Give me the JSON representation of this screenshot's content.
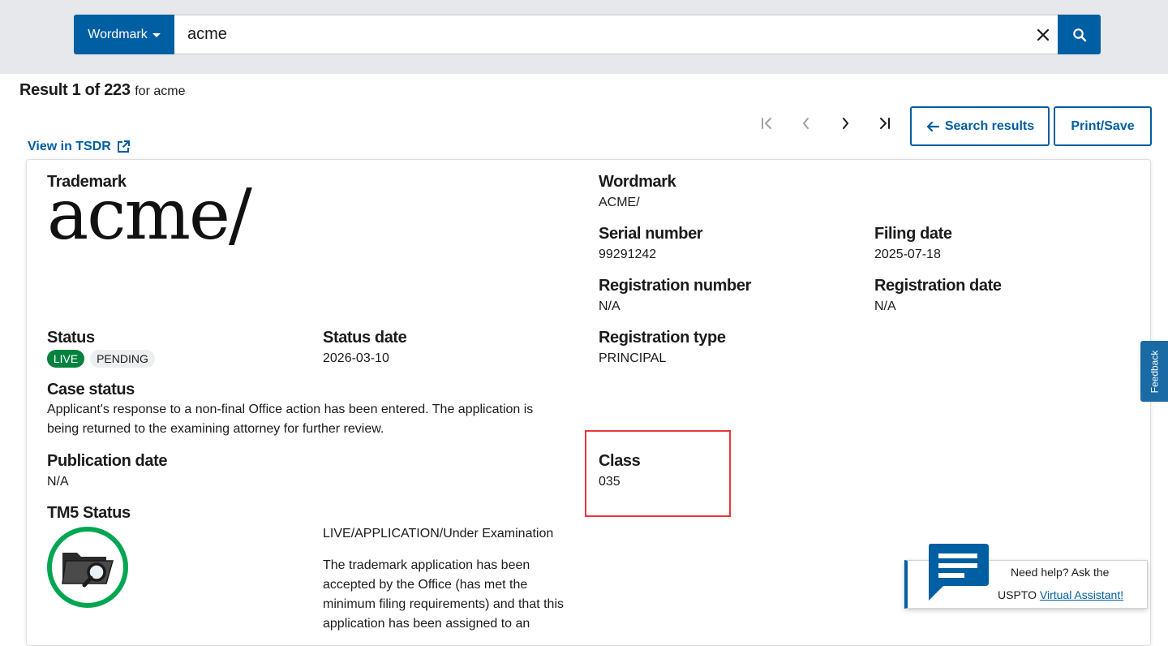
{
  "search": {
    "field_label": "Wordmark",
    "query": "acme"
  },
  "results": {
    "position": "Result 1 of 223",
    "for_text": "for acme"
  },
  "nav": {
    "search_results_label": "Search results",
    "print_save_label": "Print/Save",
    "tsdr_label": "View in TSDR"
  },
  "record": {
    "trademark_label": "Trademark",
    "mark_image_text": "acme/",
    "wordmark_label": "Wordmark",
    "wordmark_value": "ACME/",
    "serial_label": "Serial number",
    "serial_value": "99291242",
    "filing_date_label": "Filing date",
    "filing_date_value": "2025-07-18",
    "reg_number_label": "Registration number",
    "reg_number_value": "N/A",
    "reg_date_label": "Registration date",
    "reg_date_value": "N/A",
    "status_label": "Status",
    "status_tags": [
      "LIVE",
      "PENDING"
    ],
    "status_date_label": "Status date",
    "status_date_value": "2026-03-10",
    "reg_type_label": "Registration type",
    "reg_type_value": "PRINCIPAL",
    "case_status_label": "Case status",
    "case_status_line1": "Applicant's response to a non-final Office action has been entered. The application is",
    "case_status_line2": "being returned to the examining attorney for further review.",
    "pub_date_label": "Publication date",
    "pub_date_value": "N/A",
    "class_label": "Class",
    "class_value": "035",
    "tm5_label": "TM5 Status",
    "tm5_status": "LIVE/APPLICATION/Under Examination",
    "tm5_desc_lines": [
      "The trademark application has been",
      "accepted by the Office (has met the",
      "minimum filing requirements) and that this",
      "application has been assigned to an"
    ]
  },
  "feedback_label": "Feedback",
  "assistant": {
    "line1": "Need help? Ask the",
    "line2_prefix": "USPTO",
    "link": "Virtual Assistant!"
  },
  "colors": {
    "primary": "#005ea2",
    "live_green": "#00823e",
    "highlight_red": "#e5393a",
    "tm5_ring": "#00a651"
  }
}
